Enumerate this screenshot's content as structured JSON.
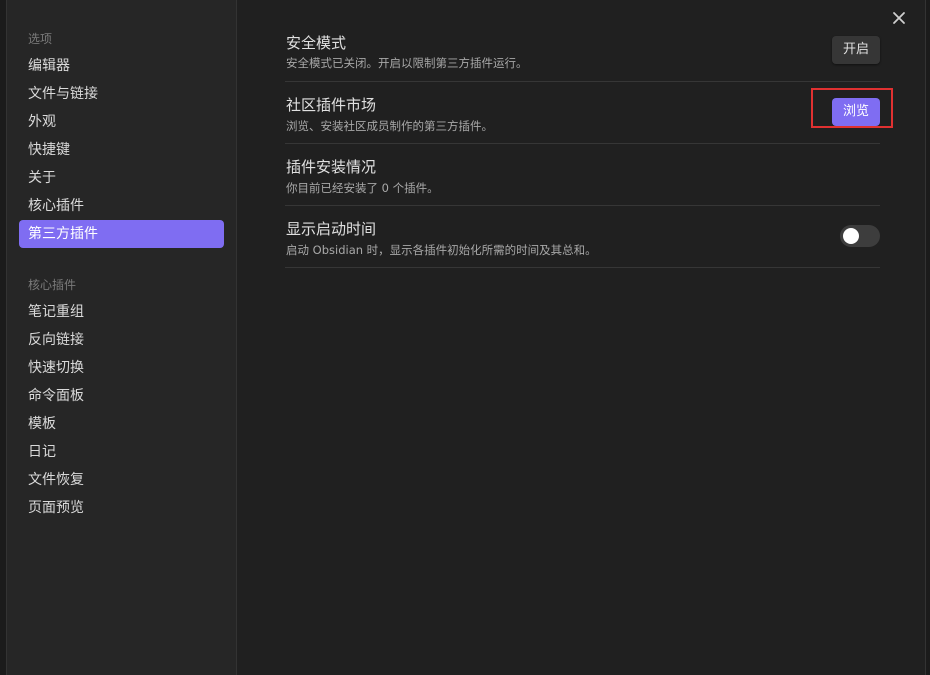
{
  "sidebar": {
    "options_header": "选项",
    "options": [
      {
        "label": "编辑器"
      },
      {
        "label": "文件与链接"
      },
      {
        "label": "外观"
      },
      {
        "label": "快捷键"
      },
      {
        "label": "关于"
      },
      {
        "label": "核心插件"
      },
      {
        "label": "第三方插件",
        "active": true
      }
    ],
    "core_header": "核心插件",
    "core_plugins": [
      {
        "label": "笔记重组"
      },
      {
        "label": "反向链接"
      },
      {
        "label": "快速切换"
      },
      {
        "label": "命令面板"
      },
      {
        "label": "模板"
      },
      {
        "label": "日记"
      },
      {
        "label": "文件恢复"
      },
      {
        "label": "页面预览"
      }
    ]
  },
  "settings": {
    "safe_mode": {
      "name": "安全模式",
      "desc": "安全模式已关闭。开启以限制第三方插件运行。",
      "button": "开启"
    },
    "community": {
      "name": "社区插件市场",
      "desc": "浏览、安装社区成员制作的第三方插件。",
      "button": "浏览"
    },
    "installed": {
      "name": "插件安装情况",
      "desc": "你目前已经安装了 0 个插件。"
    },
    "startup_time": {
      "name": "显示启动时间",
      "desc": "启动 Obsidian 时，显示各插件初始化所需的时间及其总和。",
      "toggle_on": false
    }
  },
  "colors": {
    "accent": "#7f6df2",
    "highlight_box": "#e03131"
  },
  "icons": {
    "close": "close-icon"
  }
}
